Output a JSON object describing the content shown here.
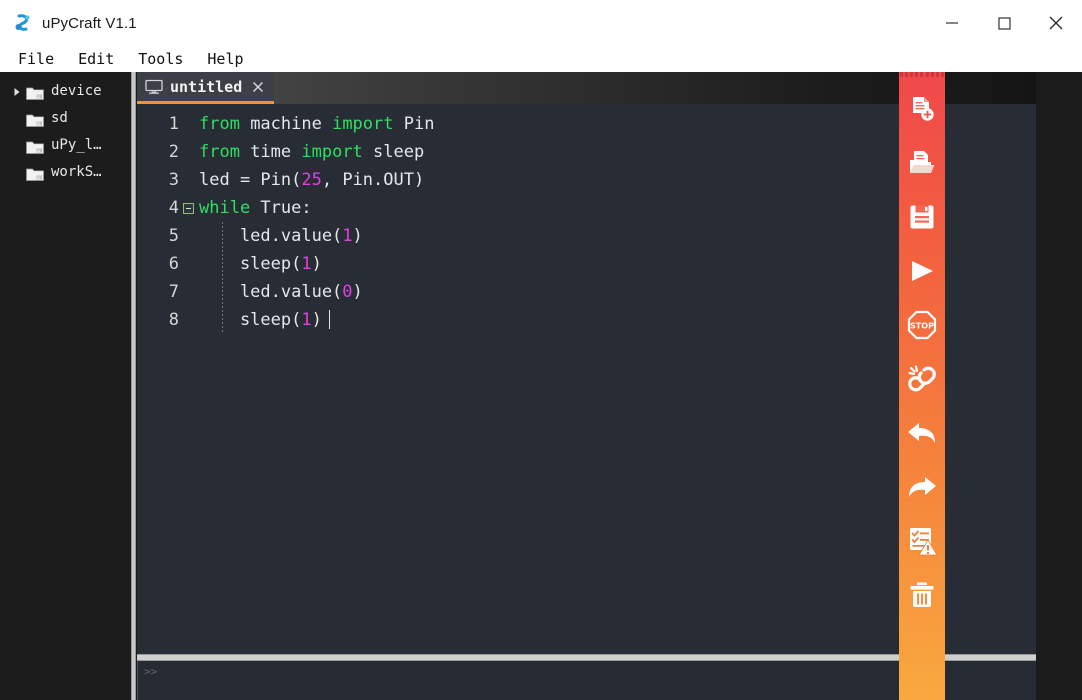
{
  "window": {
    "title": "uPyCraft V1.1",
    "app_icon": "upycraft-logo-icon",
    "controls": {
      "minimize": "minimize-icon",
      "maximize": "maximize-icon",
      "close": "close-icon"
    }
  },
  "menubar": {
    "items": [
      {
        "label": "File"
      },
      {
        "label": "Edit"
      },
      {
        "label": "Tools"
      },
      {
        "label": "Help"
      }
    ]
  },
  "sidebar": {
    "items": [
      {
        "label": "device",
        "expandable": true,
        "icon": "folder-icon"
      },
      {
        "label": "sd",
        "expandable": false,
        "icon": "folder-icon"
      },
      {
        "label": "uPy_l…",
        "expandable": false,
        "icon": "folder-icon"
      },
      {
        "label": "workS…",
        "expandable": false,
        "icon": "folder-icon"
      }
    ]
  },
  "editor": {
    "tab": {
      "label": "untitled",
      "icon": "monitor-icon",
      "close": "×",
      "active": true
    },
    "lines": [
      {
        "number": "1",
        "fold": false,
        "indent_guide": false,
        "tokens": [
          {
            "t": "from",
            "c": "kw"
          },
          {
            "t": " machine ",
            "c": "plain"
          },
          {
            "t": "import",
            "c": "kw"
          },
          {
            "t": " Pin",
            "c": "plain"
          }
        ]
      },
      {
        "number": "2",
        "fold": false,
        "indent_guide": false,
        "tokens": [
          {
            "t": "from",
            "c": "kw"
          },
          {
            "t": " time ",
            "c": "plain"
          },
          {
            "t": "import",
            "c": "kw"
          },
          {
            "t": " sleep",
            "c": "plain"
          }
        ]
      },
      {
        "number": "3",
        "fold": false,
        "indent_guide": false,
        "tokens": [
          {
            "t": "led = Pin(",
            "c": "plain"
          },
          {
            "t": "25",
            "c": "num"
          },
          {
            "t": ", Pin.OUT)",
            "c": "plain"
          }
        ]
      },
      {
        "number": "4",
        "fold": true,
        "indent_guide": false,
        "tokens": [
          {
            "t": "while",
            "c": "kw"
          },
          {
            "t": " True:",
            "c": "plain"
          }
        ]
      },
      {
        "number": "5",
        "fold": false,
        "indent_guide": true,
        "tokens": [
          {
            "t": "    led.value(",
            "c": "plain"
          },
          {
            "t": "1",
            "c": "num"
          },
          {
            "t": ")",
            "c": "plain"
          }
        ]
      },
      {
        "number": "6",
        "fold": false,
        "indent_guide": true,
        "tokens": [
          {
            "t": "    sleep(",
            "c": "plain"
          },
          {
            "t": "1",
            "c": "num"
          },
          {
            "t": ")",
            "c": "plain"
          }
        ]
      },
      {
        "number": "7",
        "fold": false,
        "indent_guide": true,
        "tokens": [
          {
            "t": "    led.value(",
            "c": "plain"
          },
          {
            "t": "0",
            "c": "num"
          },
          {
            "t": ")",
            "c": "plain"
          }
        ]
      },
      {
        "number": "8",
        "fold": false,
        "indent_guide": true,
        "caret": true,
        "tokens": [
          {
            "t": "    sleep(",
            "c": "plain"
          },
          {
            "t": "1",
            "c": "num"
          },
          {
            "t": ")",
            "c": "plain"
          }
        ]
      }
    ]
  },
  "output": {
    "prompt": ">>"
  },
  "toolbar": {
    "buttons": [
      {
        "name": "new-file-button",
        "icon": "new-file-icon"
      },
      {
        "name": "open-file-button",
        "icon": "open-folder-icon"
      },
      {
        "name": "save-file-button",
        "icon": "save-floppy-icon"
      },
      {
        "name": "run-button",
        "icon": "play-icon"
      },
      {
        "name": "stop-button",
        "icon": "stop-sign-icon"
      },
      {
        "name": "disconnect-button",
        "icon": "broken-link-icon"
      },
      {
        "name": "undo-button",
        "icon": "undo-arrow-icon"
      },
      {
        "name": "redo-button",
        "icon": "redo-arrow-icon"
      },
      {
        "name": "syntax-check-button",
        "icon": "checklist-warning-icon"
      },
      {
        "name": "delete-button",
        "icon": "trash-icon"
      }
    ]
  },
  "colors": {
    "toolbar_top": "#f0484a",
    "toolbar_bottom": "#f9a93f",
    "editor_bg": "#282c34",
    "sidebar_bg": "#1c1c1c",
    "tab_underline": "#e8953c",
    "keyword": "#2fdf62",
    "number": "#e040e0",
    "text": "#dcdfe4"
  }
}
